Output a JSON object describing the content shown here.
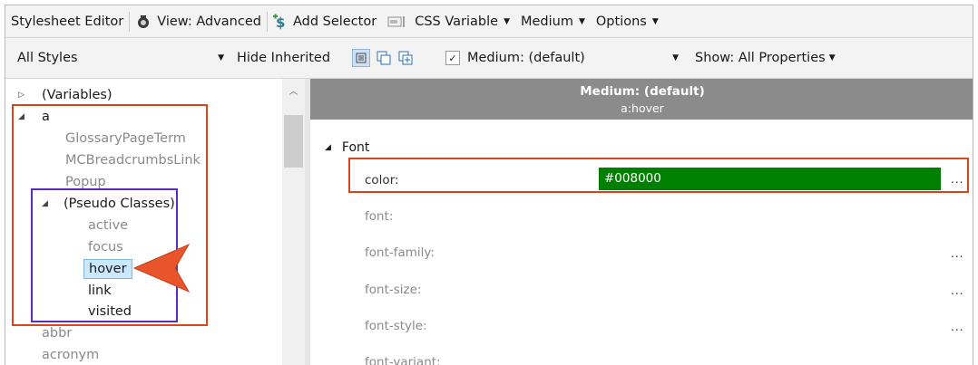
{
  "toolbar": {
    "title": "Stylesheet Editor",
    "view_label": "View: Advanced",
    "add_selector": "Add Selector",
    "css_variable": "CSS Variable",
    "medium": "Medium",
    "options": "Options"
  },
  "filterbar": {
    "styles_select": "All Styles",
    "hide_inherited": "Hide Inherited",
    "medium_check": "Medium: (default)",
    "show_select": "Show: All Properties"
  },
  "tree": {
    "variables": "(Variables)",
    "a": "a",
    "glossary": "GlossaryPageTerm",
    "breadcrumbs": "MCBreadcrumbsLink",
    "popup": "Popup",
    "pseudo": "(Pseudo Classes)",
    "active": "active",
    "focus": "focus",
    "hover": "hover",
    "link": "link",
    "visited": "visited",
    "abbr": "abbr",
    "acronym": "acronym"
  },
  "panel": {
    "medium_title": "Medium: (default)",
    "selector": "a:hover",
    "group": "Font",
    "props": {
      "color": "color:",
      "font": "font:",
      "font_family": "font-family:",
      "font_size": "font-size:",
      "font_style": "font-style:",
      "font_variant": "font-variant:"
    },
    "color_value": "#008000",
    "ellipsis": "..."
  },
  "colors": {
    "highlight_red": "#d9461c",
    "highlight_purple": "#5b2bc0",
    "arrow": "#e9542a",
    "value_green": "#008000"
  }
}
